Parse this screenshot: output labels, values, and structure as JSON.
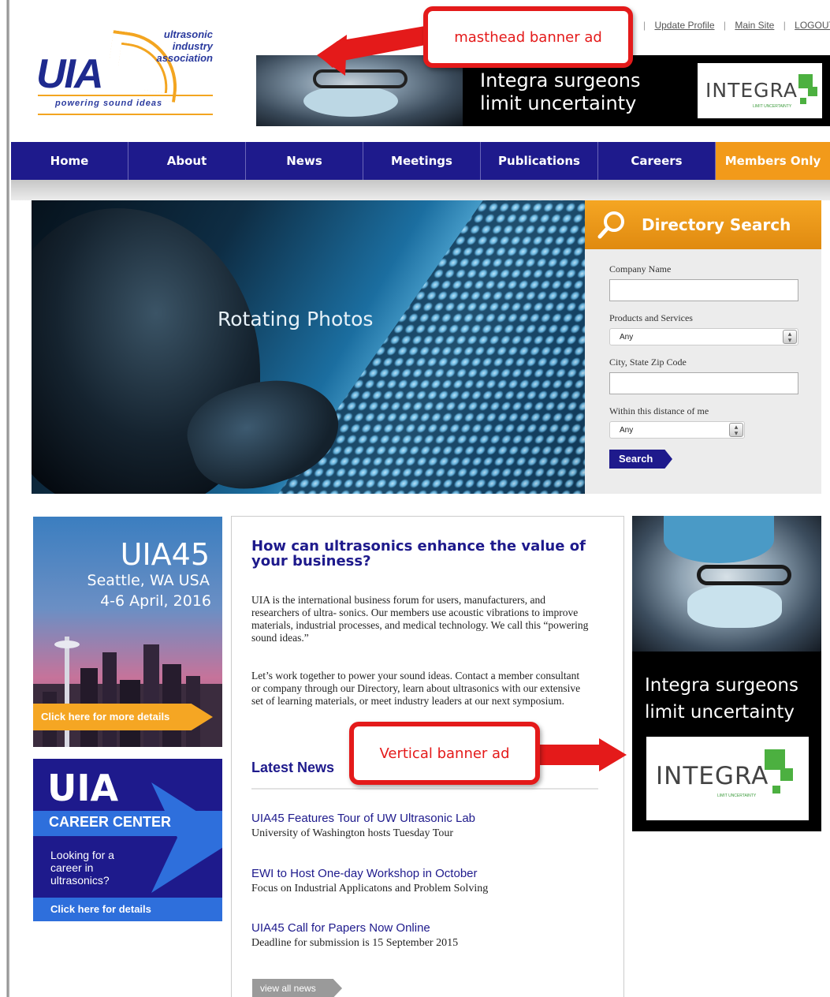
{
  "top_links": [
    "Update Profile",
    "Main Site",
    "LOGOUT"
  ],
  "logo": {
    "mark": "UIA",
    "name_lines": [
      "ultrasonic",
      "industry",
      "association"
    ],
    "tagline": "powering sound ideas"
  },
  "masthead_ad": {
    "headline_lines": [
      "Integra surgeons",
      "limit uncertainty"
    ],
    "brand": "INTEGRA",
    "brand_sub": "LIMIT UNCERTAINTY"
  },
  "nav": {
    "items": [
      "Home",
      "About",
      "News",
      "Meetings",
      "Publications",
      "Careers",
      "Members Only"
    ]
  },
  "hero": {
    "caption": "Rotating Photos"
  },
  "directory": {
    "title": "Directory Search",
    "company_label": "Company Name",
    "company_value": "",
    "products_label": "Products and Services",
    "products_value": "Any",
    "city_label": "City, State Zip Code",
    "city_value": "",
    "distance_label": "Within this distance of me",
    "distance_value": "Any",
    "search_button": "Search"
  },
  "promo_event": {
    "title": "UIA45",
    "location": "Seattle, WA USA",
    "dates": "4-6 April, 2016",
    "cta": "Click here for more details"
  },
  "promo_career": {
    "title": "UIA",
    "subtitle": "CAREER CENTER",
    "text": "Looking for a career in ultrasonics?",
    "cta": "Click here for details"
  },
  "main": {
    "heading": "How can ultrasonics enhance the value of your business?",
    "para1": "UIA is the international business forum for users, manufacturers, and researchers of ultra- sonics. Our members use acoustic vibrations to improve materials, industrial processes, and medical technology. We call this “powering sound ideas.”",
    "para2": "Let’s work together to power your sound ideas. Contact a member consultant or company through our Directory, learn about ultrasonics with our extensive set of learning materials, or meet industry leaders at our next symposium.",
    "latest_news_heading": "Latest News",
    "news": [
      {
        "headline": "UIA45 Features Tour of UW Ultrasonic Lab",
        "summary": "University of Washington hosts Tuesday Tour"
      },
      {
        "headline": "EWI to Host One-day Workshop in October",
        "summary": "Focus on Industrial Applicatons and Problem Solving"
      },
      {
        "headline": "UIA45 Call for Papers Now Online",
        "summary": "Deadline for submission is 15 September 2015"
      }
    ],
    "view_all": "view all news"
  },
  "vertical_ad": {
    "headline_lines": [
      "Integra surgeons",
      "limit uncertainty"
    ],
    "brand": "INTEGRA",
    "brand_sub": "LIMIT UNCERTAINTY"
  },
  "annotations": {
    "masthead": "masthead banner ad",
    "vertical": "Vertical banner ad",
    "color": "#e41a1a"
  }
}
